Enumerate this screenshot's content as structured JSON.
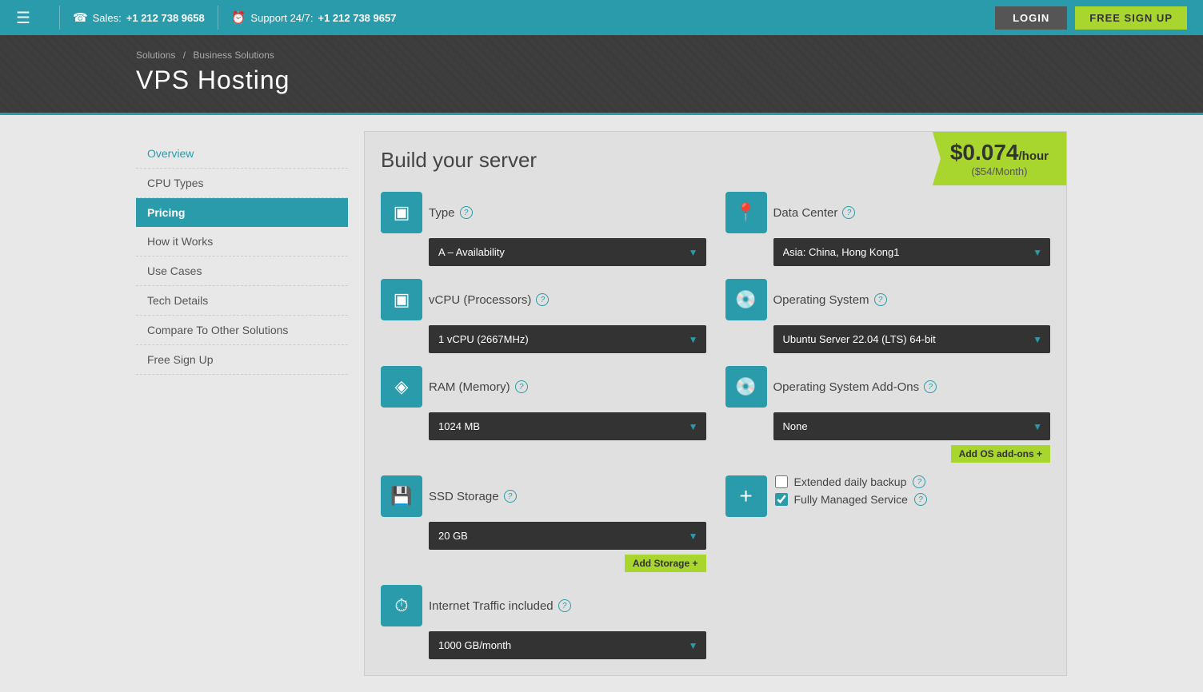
{
  "topnav": {
    "hamburger": "☰",
    "sales_label": "Sales:",
    "sales_phone": "+1 212 738 9658",
    "support_label": "Support 24/7:",
    "support_phone": "+1 212 738 9657",
    "login_label": "LOGIN",
    "signup_label": "FREE SIGN UP"
  },
  "header": {
    "breadcrumb_solutions": "Solutions",
    "breadcrumb_sep": "/",
    "breadcrumb_sub": "Business Solutions",
    "page_title": "VPS Hosting"
  },
  "sidebar": {
    "items": [
      {
        "label": "Overview",
        "class": "overview"
      },
      {
        "label": "CPU Types",
        "class": ""
      },
      {
        "label": "Pricing",
        "class": "active"
      },
      {
        "label": "How it Works",
        "class": ""
      },
      {
        "label": "Use Cases",
        "class": ""
      },
      {
        "label": "Tech Details",
        "class": ""
      },
      {
        "label": "Compare To Other Solutions",
        "class": ""
      },
      {
        "label": "Free Sign Up",
        "class": ""
      }
    ]
  },
  "builder": {
    "title": "Build your server",
    "price_main": "$0.074",
    "price_per": "/hour",
    "price_month": "($54/Month)",
    "type_label": "Type",
    "type_value": "A – Availability",
    "datacenter_label": "Data Center",
    "datacenter_value": "Asia: China, Hong Kong1",
    "vcpu_label": "vCPU (Processors)",
    "vcpu_value": "1 vCPU (2667MHz)",
    "os_label": "Operating System",
    "os_value": "Ubuntu Server 22.04 (LTS) 64-bit",
    "ram_label": "RAM (Memory)",
    "ram_value": "1024 MB",
    "os_addons_label": "Operating System Add-Ons",
    "os_addons_value": "None",
    "add_os_addons": "Add OS add-ons +",
    "ssd_label": "SSD Storage",
    "ssd_value": "20 GB",
    "add_storage": "Add Storage +",
    "extended_backup_label": "Extended daily backup",
    "fully_managed_label": "Fully Managed Service",
    "internet_label": "Internet Traffic included",
    "internet_value": "1000 GB/month",
    "help": "?"
  },
  "icons": {
    "type": "▣",
    "datacenter": "📍",
    "vcpu": "▣",
    "os": "💿",
    "ram": "◈",
    "os_addons": "💿",
    "ssd": "💾",
    "plus": "+",
    "internet": "⏱"
  }
}
